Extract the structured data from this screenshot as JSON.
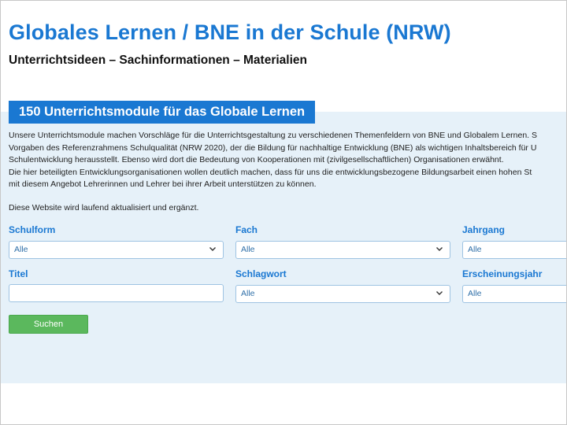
{
  "header": {
    "title": "Globales Lernen / BNE in der Schule (NRW)",
    "subtitle": "Unterrichtsideen – Sachinformationen – Materialien"
  },
  "section": {
    "heading": "150 Unterrichtsmodule für das Globale Lernen",
    "intro_lines": [
      "Unsere Unterrichtsmodule machen Vorschläge für die Unterrichtsgestaltung zu verschiedenen Themenfeldern von BNE und Globalem Lernen. S",
      "Vorgaben des Referenzrahmens Schulqualität (NRW 2020), der die Bildung für nachhaltige Entwicklung (BNE) als wichtigen Inhaltsbereich für U",
      "Schulentwicklung herausstellt. Ebenso wird dort die Bedeutung von Kooperationen mit (zivilgesellschaftlichen) Organisationen erwähnt.",
      "Die hier beteiligten Entwicklungsorganisationen wollen deutlich machen, dass für uns die entwicklungsbezogene Bildungsarbeit einen hohen St",
      "mit diesem Angebot Lehrerinnen und Lehrer bei ihrer Arbeit unterstützen zu können."
    ],
    "update_note": "Diese Website wird laufend aktualisiert und ergänzt."
  },
  "filters": {
    "schulform": {
      "label": "Schulform",
      "value": "Alle"
    },
    "fach": {
      "label": "Fach",
      "value": "Alle"
    },
    "jahrgang": {
      "label": "Jahrgang",
      "value": "Alle"
    },
    "titel": {
      "label": "Titel",
      "value": ""
    },
    "schlagwort": {
      "label": "Schlagwort",
      "value": "Alle"
    },
    "erscheinungsjahr": {
      "label": "Erscheinungsjahr",
      "value": "Alle"
    }
  },
  "search_button": {
    "label": "Suchen"
  },
  "colors": {
    "accent_blue": "#1a78d2",
    "panel_bg": "#e6f1f9",
    "button_green": "#5bb85d"
  },
  "icons": {
    "dropdown": "chevron-down-icon"
  }
}
